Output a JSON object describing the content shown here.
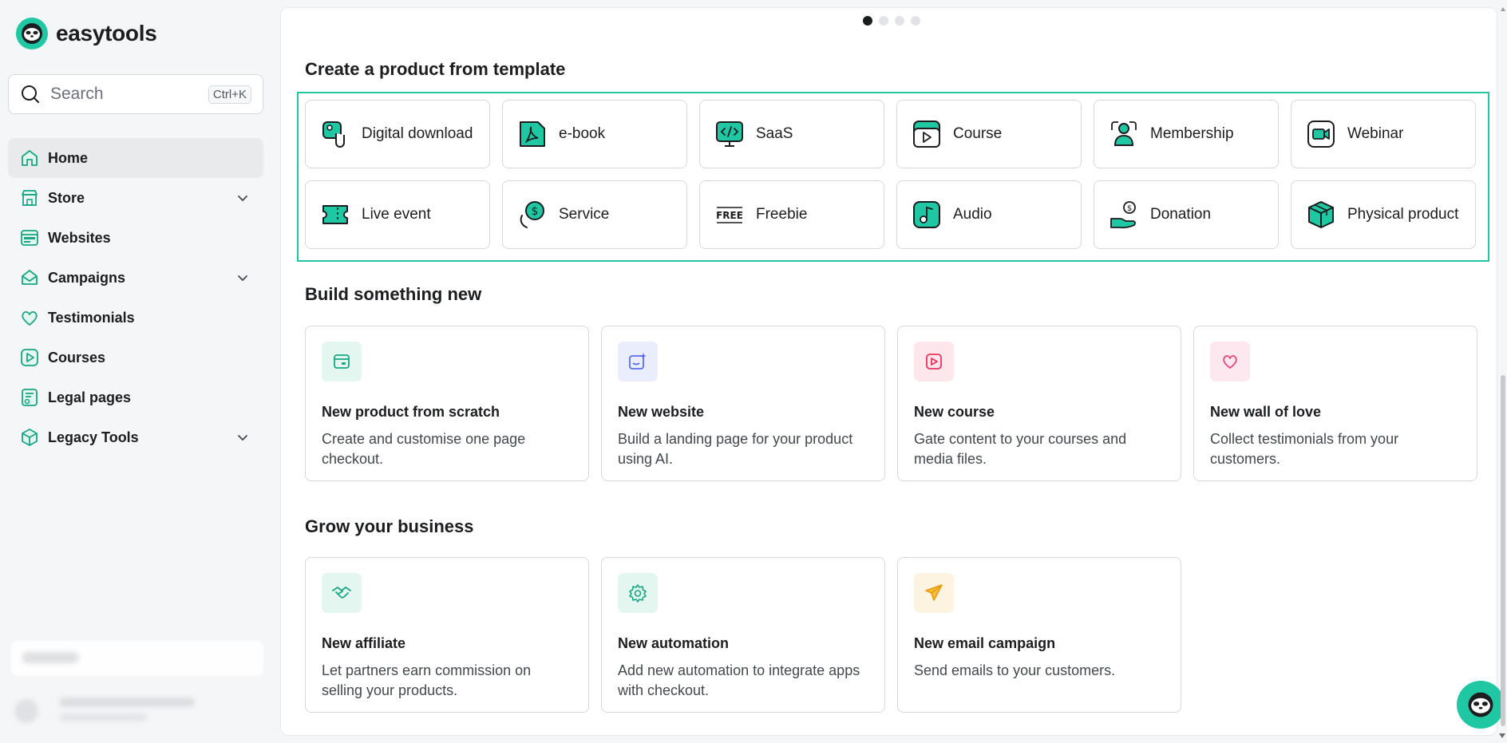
{
  "brand": {
    "name": "easytools",
    "accent": "#1fc8a3"
  },
  "search": {
    "placeholder": "Search",
    "shortcut": "Ctrl+K"
  },
  "sidebar": {
    "items": [
      {
        "label": "Home",
        "icon": "home-icon",
        "active": true
      },
      {
        "label": "Store",
        "icon": "store-icon",
        "expandable": true
      },
      {
        "label": "Websites",
        "icon": "websites-icon"
      },
      {
        "label": "Campaigns",
        "icon": "campaigns-icon",
        "expandable": true
      },
      {
        "label": "Testimonials",
        "icon": "heart-icon"
      },
      {
        "label": "Courses",
        "icon": "play-icon"
      },
      {
        "label": "Legal pages",
        "icon": "legal-icon"
      },
      {
        "label": "Legacy Tools",
        "icon": "box-icon",
        "expandable": true
      }
    ]
  },
  "carousel": {
    "pages": 4,
    "active": 1
  },
  "templates": {
    "title": "Create a product from template",
    "items": [
      {
        "label": "Digital download",
        "icon": "digital-download-icon"
      },
      {
        "label": "e-book",
        "icon": "pdf-icon"
      },
      {
        "label": "SaaS",
        "icon": "code-monitor-icon"
      },
      {
        "label": "Course",
        "icon": "course-icon"
      },
      {
        "label": "Membership",
        "icon": "membership-icon"
      },
      {
        "label": "Webinar",
        "icon": "webinar-icon"
      },
      {
        "label": "Live event",
        "icon": "ticket-icon"
      },
      {
        "label": "Service",
        "icon": "service-icon"
      },
      {
        "label": "Freebie",
        "icon": "free-icon"
      },
      {
        "label": "Audio",
        "icon": "audio-icon"
      },
      {
        "label": "Donation",
        "icon": "donation-icon"
      },
      {
        "label": "Physical product",
        "icon": "package-icon"
      }
    ]
  },
  "build": {
    "title": "Build something new",
    "cards": [
      {
        "title": "New product from scratch",
        "desc": "Create and customise one page checkout.",
        "icon": "product-icon",
        "tint": "#e3f6f0",
        "color": "#1aa584"
      },
      {
        "title": "New website",
        "desc": "Build a landing page for your product using AI.",
        "icon": "website-ai-icon",
        "tint": "#e9edfc",
        "color": "#5b6ee8"
      },
      {
        "title": "New course",
        "desc": "Gate content to your courses and media files.",
        "icon": "course-play-icon",
        "tint": "#fde6ec",
        "color": "#e8355f"
      },
      {
        "title": "New wall of love",
        "desc": "Collect testimonials from your customers.",
        "icon": "heart-icon",
        "tint": "#fde8ef",
        "color": "#e8467a"
      }
    ]
  },
  "grow": {
    "title": "Grow your business",
    "cards": [
      {
        "title": "New affiliate",
        "desc": "Let partners earn commission on selling your products.",
        "icon": "handshake-icon",
        "tint": "#e3f6f0",
        "color": "#1aa584"
      },
      {
        "title": "New automation",
        "desc": "Add new automation to integrate apps with checkout.",
        "icon": "gear-icon",
        "tint": "#e3f6f0",
        "color": "#1aa584"
      },
      {
        "title": "New email campaign",
        "desc": "Send emails to your customers.",
        "icon": "paper-plane-icon",
        "tint": "#fdf3e1",
        "color": "#f2a516"
      }
    ]
  }
}
